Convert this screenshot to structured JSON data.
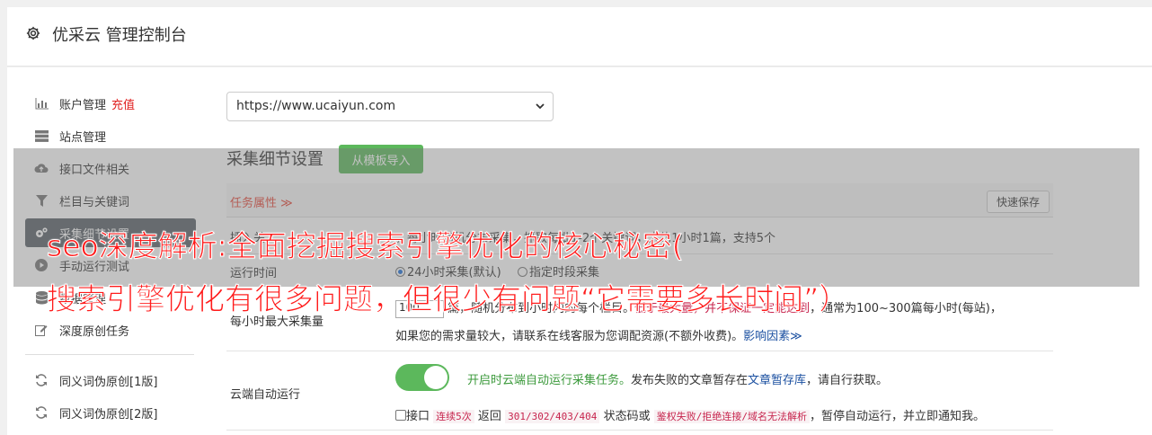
{
  "header": {
    "title": "优采云 管理控制台",
    "icon": "gear-icon"
  },
  "sidebar": {
    "items": [
      {
        "label": "账户管理",
        "badge": "充值",
        "icon": "bar-chart-icon"
      },
      {
        "label": "站点管理",
        "icon": "server-icon"
      },
      {
        "label": "接口文件相关",
        "icon": "cloud-upload-icon"
      },
      {
        "label": "栏目与关键词",
        "icon": "filter-icon"
      },
      {
        "label": "采集细节设置",
        "icon": "gears-icon"
      },
      {
        "label": "手动运行测试",
        "icon": "play-circle-icon"
      },
      {
        "label": "数据管理",
        "icon": "database-icon"
      },
      {
        "label": "深度原创任务",
        "icon": "edit-icon"
      },
      {
        "label": "同义词伪原创[1版]",
        "icon": "refresh-icon"
      },
      {
        "label": "同义词伪原创[2版]",
        "icon": "refresh-icon"
      }
    ]
  },
  "site_select": {
    "value": "https://www.ucaiyun.com"
  },
  "section": {
    "title": "采集细节设置",
    "template_button": "从模板导入"
  },
  "task_bar": {
    "label": "任务属性 ≫",
    "save_button": "快速保存"
  },
  "row_keyword": {
    "label": "插入关",
    "text": "，每小时随机分布采集，抓取每批1-2个关键词，大约1小时1篇，支持5个"
  },
  "row_runtime": {
    "label": "运行时间",
    "option_24h": "24小时采集(默认)",
    "option_period": "指定时段采集"
  },
  "row_max": {
    "label": "每小时最大采集量",
    "input_value": "100",
    "text_a": "篇，随机分布到小时内的每个栏目。",
    "text_red": "低于最大量，并不保证一定能达到",
    "text_b": "，通常为100~300篇每小时(每站)，",
    "text_c": "如果您的需求量较大，请联系在线客服为您调配资源(不额外收费)。",
    "link": "影响因素≫"
  },
  "row_cloud": {
    "label": "云端自动运行",
    "toggle_on": true,
    "green_text": "开启时云端自动运行采集任务。",
    "text_a": "发布失败的文章暂存在",
    "link": "文章暂存库",
    "text_b": "，请自行获取。",
    "chk_label": "接口",
    "code1": "连续5次",
    "text_c": "返回",
    "code2": "301/302/403/404",
    "text_d": "状态码或",
    "code3": "鉴权失败/拒绝连接/域名无法解析",
    "text_e": "，暂停自动运行，并立即通知我。"
  },
  "watermark": {
    "line1": "seo深度解析:全面挖掘搜索引擎优化的核心秘密(",
    "line2": "搜索引擎优化有很多问题，但很少有问题“它需要多长时间”）"
  },
  "colors": {
    "accent_green": "#5cb85c",
    "watermark_red": "#ff1a1a",
    "active_nav": "#5a6268"
  }
}
